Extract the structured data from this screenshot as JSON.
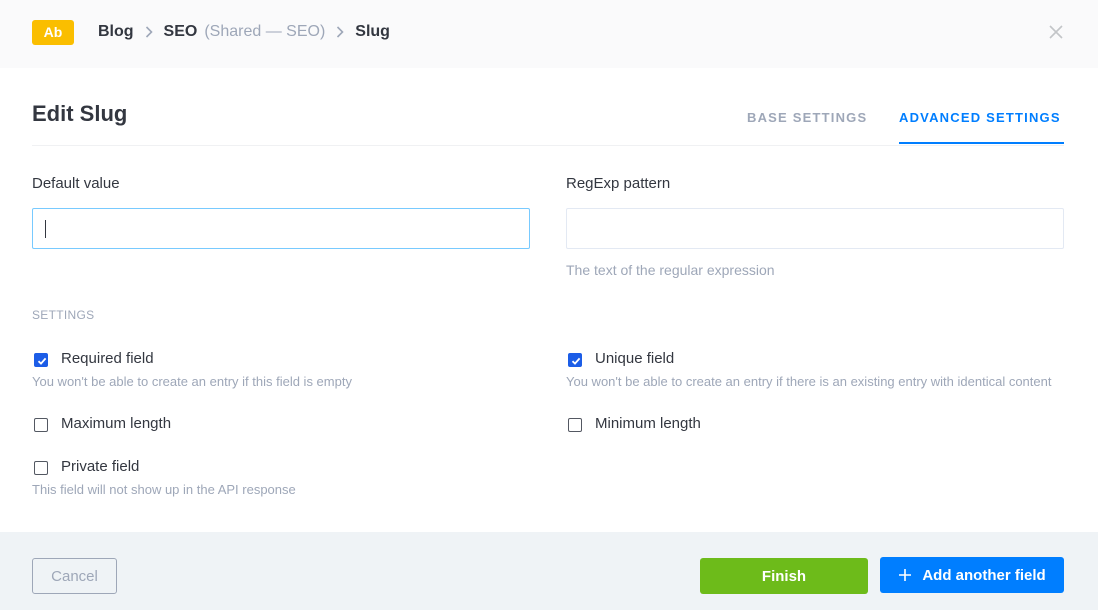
{
  "header": {
    "badge": "Ab",
    "breadcrumb": {
      "items": [
        "Blog",
        "SEO",
        "Slug"
      ],
      "sub": "(Shared — SEO)"
    }
  },
  "modal": {
    "title": "Edit Slug",
    "tabs": [
      {
        "label": "BASE SETTINGS",
        "active": false
      },
      {
        "label": "ADVANCED SETTINGS",
        "active": true
      }
    ]
  },
  "fields": {
    "default_value": {
      "label": "Default value",
      "value": ""
    },
    "regexp": {
      "label": "RegExp pattern",
      "value": "",
      "hint": "The text of the regular expression"
    }
  },
  "settings": {
    "section_label": "SETTINGS",
    "required": {
      "label": "Required field",
      "checked": true,
      "desc": "You won't be able to create an entry if this field is empty"
    },
    "unique": {
      "label": "Unique field",
      "checked": true,
      "desc": "You won't be able to create an entry if there is an existing entry with identical content"
    },
    "max_length": {
      "label": "Maximum length",
      "checked": false
    },
    "min_length": {
      "label": "Minimum length",
      "checked": false
    },
    "private": {
      "label": "Private field",
      "checked": false,
      "desc": "This field will not show up in the API response"
    }
  },
  "footer": {
    "cancel": "Cancel",
    "finish": "Finish",
    "add": "Add another field"
  },
  "colors": {
    "accent": "#007eff",
    "finish": "#6dbb1a",
    "badge": "#fabe00",
    "checkbox": "#1c5de7"
  }
}
